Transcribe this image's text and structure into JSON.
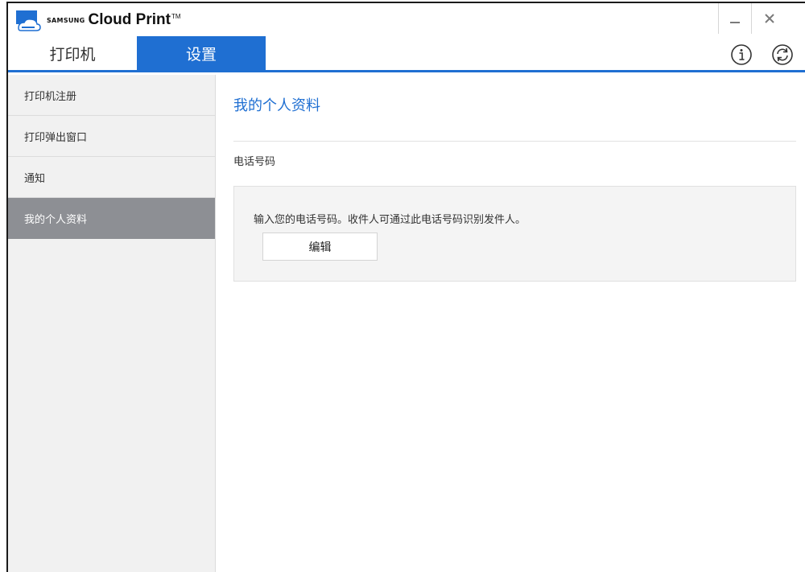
{
  "app": {
    "brand_samsung": "SAMSUNG",
    "brand_name": "Cloud Print",
    "brand_tm": "TM"
  },
  "window_controls": {
    "minimize_icon": "minimize-icon",
    "close_icon": "close-icon"
  },
  "tabs": [
    {
      "label": "打印机",
      "active": false
    },
    {
      "label": "设置",
      "active": true
    }
  ],
  "toolbar": {
    "info_icon": "info-icon",
    "refresh_icon": "refresh-icon"
  },
  "sidebar": {
    "items": [
      {
        "label": "打印机注册",
        "active": false
      },
      {
        "label": "打印弹出窗口",
        "active": false
      },
      {
        "label": "通知",
        "active": false
      },
      {
        "label": "我的个人资料",
        "active": true
      }
    ]
  },
  "main": {
    "title": "我的个人资料",
    "section_label": "电话号码",
    "info_text": "输入您的电话号码。收件人可通过此电话号码识别发件人。",
    "edit_label": "编辑"
  },
  "colors": {
    "accent": "#1f6fd2",
    "sidebar_bg": "#f1f1f1",
    "sidebar_active": "#8d8f94",
    "box_bg": "#f4f4f4"
  }
}
